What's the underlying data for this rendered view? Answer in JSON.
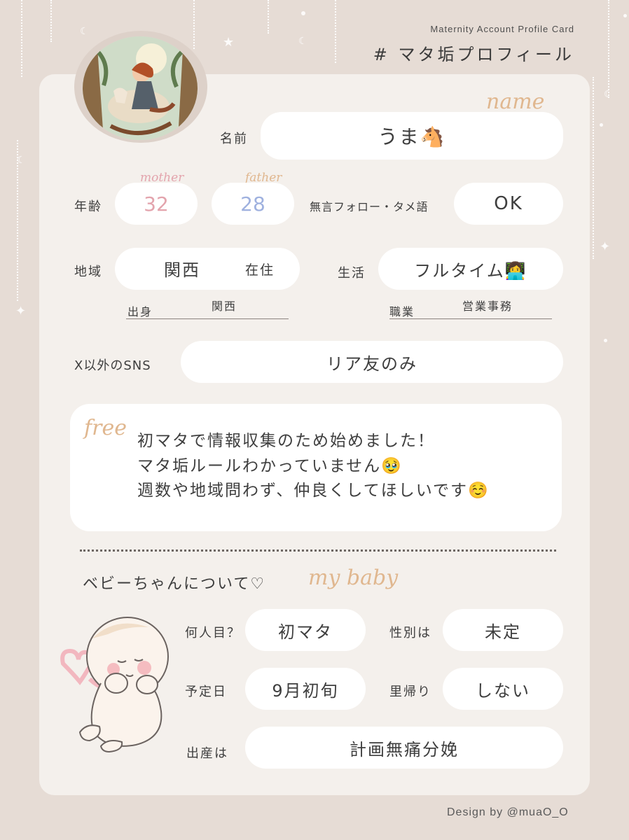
{
  "header": {
    "subtitle": "Maternity Account Profile Card",
    "title": "# マタ垢プロフィール"
  },
  "profile": {
    "name_script": "name",
    "name_label": "名前",
    "name_value": "うま🐴",
    "age_label": "年齢",
    "mother_script": "mother",
    "mother_age": "32",
    "father_script": "father",
    "father_age": "28",
    "follow_label": "無言フォロー・タメ語",
    "follow_value": "OK",
    "region_label": "地域",
    "region_value": "関西",
    "region_suffix": "在住",
    "origin_label": "出身",
    "origin_value": "関西",
    "life_label": "生活",
    "life_value": "フルタイム👩‍💻",
    "job_label": "職業",
    "job_value": "営業事務",
    "sns_label": "X以外のSNS",
    "sns_value": "リア友のみ"
  },
  "free": {
    "script": "free",
    "lines": [
      "初マタで情報収集のため始めました！",
      "マタ垢ルールわかっていません🥹",
      "週数や地域問わず、仲良くしてほしいです☺️"
    ]
  },
  "baby": {
    "heading": "ベビーちゃんについて♡",
    "script": "my baby",
    "count_label": "何人目？",
    "count_value": "初マタ",
    "sex_label": "性別は",
    "sex_value": "未定",
    "due_label": "予定日",
    "due_value": "9月初旬",
    "return_label": "里帰り",
    "return_value": "しない",
    "birth_label": "出産は",
    "birth_value": "計画無痛分娩"
  },
  "footer": {
    "credit": "Design by @muaO_O"
  },
  "colors": {
    "background": "#e6dcd5",
    "card": "#f4f0ec",
    "mother": "#e3a4ad",
    "father": "#9fb1df",
    "script": "#e0b78f"
  }
}
